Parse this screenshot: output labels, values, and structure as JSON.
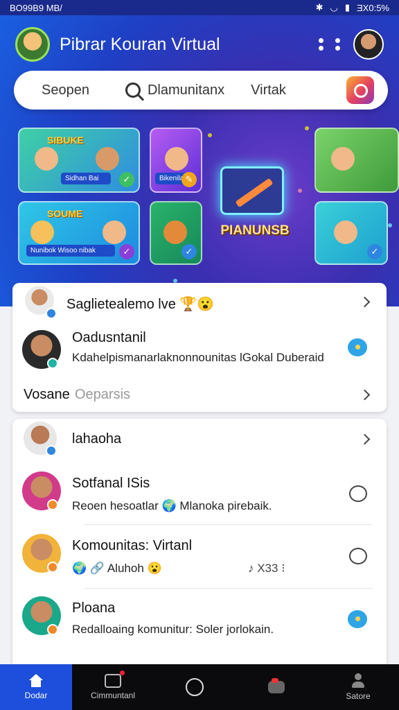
{
  "status_bar": {
    "left": "BO99B9 MB/",
    "right": "ƎX0:5%"
  },
  "header": {
    "title": "Pibrar Kouran Virtual"
  },
  "search": {
    "left_label": "Seopen",
    "middle_label": "Dlamunitanx",
    "right_label": "Virtak"
  },
  "banner": {
    "tiles": [
      {
        "title": "SIBUKE",
        "caption": "Sidhan Bai"
      },
      {
        "title": "",
        "caption": "Bikenilais"
      },
      {
        "title": "SOUME",
        "caption": "Nunibok Wisoo nibak"
      },
      {
        "title": "",
        "caption": ""
      }
    ],
    "center_label": "PIANUNSB"
  },
  "card1": {
    "header_row": {
      "name": "Saglietealemo lve 🏆😮"
    },
    "row1": {
      "name": "Oadusntanil",
      "sub": "Kdahelpismanarlaknonnounitas lGokal Duberaid"
    },
    "footer": {
      "label": "Vosane",
      "sub": "Oeparsis"
    }
  },
  "card2": {
    "rows": [
      {
        "name": "lahaoha",
        "sub": ""
      },
      {
        "name": "Sotfanal ISis",
        "sub": "Reoen hesoatlar 🌍 Mlanoka pirebaik."
      },
      {
        "name": "Komounitas: Virtanl",
        "sub": "🌍 🔗 Aluhoh 😮",
        "extra": "♪ X33 ⁝"
      },
      {
        "name": "Ploana",
        "sub": "Redalloaing komunitur: Soler jorlokain."
      }
    ]
  },
  "nav": {
    "items": [
      {
        "label": "Dodar",
        "icon": "home-icon"
      },
      {
        "label": "Cimmuntanl",
        "icon": "chat-icon"
      },
      {
        "label": "",
        "icon": "circle-icon"
      },
      {
        "label": "",
        "icon": "game-icon"
      },
      {
        "label": "Satore",
        "icon": "user-icon"
      }
    ]
  },
  "colors": {
    "accent": "#1d4fdc",
    "hero": "#2a44c8",
    "bubble": "#2fa4e7"
  }
}
